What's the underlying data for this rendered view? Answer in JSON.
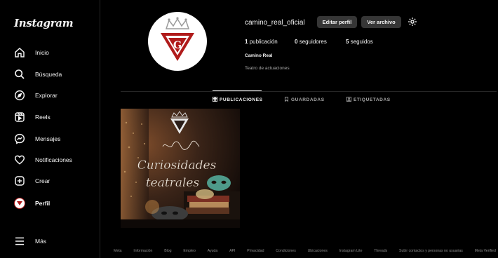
{
  "app": {
    "logo": "Instagram"
  },
  "sidebar": {
    "items": [
      {
        "label": "Inicio",
        "icon": "home-icon"
      },
      {
        "label": "Búsqueda",
        "icon": "search-icon"
      },
      {
        "label": "Explorar",
        "icon": "compass-icon"
      },
      {
        "label": "Reels",
        "icon": "reels-icon"
      },
      {
        "label": "Mensajes",
        "icon": "messenger-icon"
      },
      {
        "label": "Notificaciones",
        "icon": "heart-icon"
      },
      {
        "label": "Crear",
        "icon": "plus-square-icon"
      },
      {
        "label": "Perfil",
        "icon": "avatar"
      },
      {
        "label": "Más",
        "icon": "menu-icon"
      }
    ]
  },
  "profile": {
    "username": "camino_real_oficial",
    "edit_label": "Editar perfil",
    "archive_label": "Ver archivo",
    "stats": {
      "posts_count": "1",
      "posts_label": "publicación",
      "followers_count": "0",
      "followers_label": "seguidores",
      "following_count": "5",
      "following_label": "seguidos"
    },
    "full_name": "Camino Real",
    "bio": "Teatro de actuaciones"
  },
  "tabs": [
    {
      "label": "PUBLICACIONES",
      "active": true
    },
    {
      "label": "GUARDADAS",
      "active": false
    },
    {
      "label": "ETIQUETADAS",
      "active": false
    }
  ],
  "post": {
    "line1": "Curiosidades",
    "line2": "teatrales"
  },
  "footer": {
    "links": [
      "Meta",
      "Información",
      "Blog",
      "Empleo",
      "Ayuda",
      "API",
      "Privacidad",
      "Condiciones",
      "Ubicaciones",
      "Instagram Lite",
      "Threads",
      "Subir contactos y personas no usuarias",
      "Meta Verified"
    ]
  },
  "colors": {
    "background": "#000000",
    "button": "#363636",
    "brand_red": "#b01b1b",
    "muted": "#a8a8a8"
  }
}
